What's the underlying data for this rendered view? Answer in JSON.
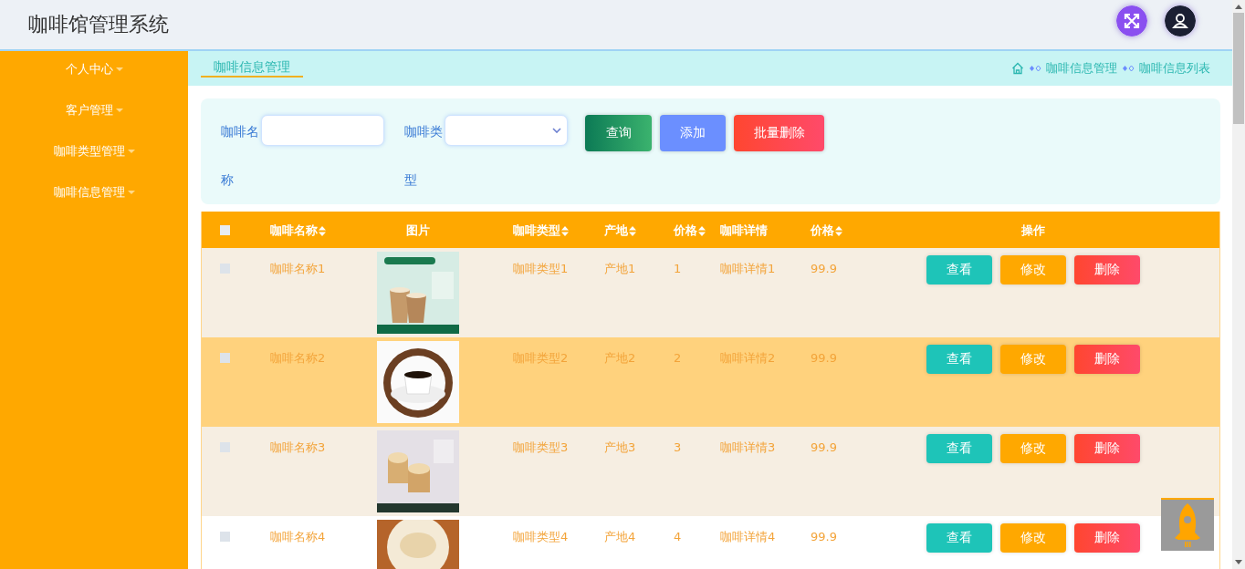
{
  "app": {
    "title": "咖啡馆管理系统"
  },
  "sidebar": {
    "items": [
      {
        "label": "个人中心"
      },
      {
        "label": "客户管理"
      },
      {
        "label": "咖啡类型管理"
      },
      {
        "label": "咖啡信息管理"
      }
    ]
  },
  "tabs": [
    {
      "label": "咖啡信息管理",
      "selected": true
    }
  ],
  "breadcrumb": [
    "咖啡信息管理",
    "咖啡信息列表"
  ],
  "search": {
    "fields": [
      {
        "kind": "text",
        "label": "咖啡名称"
      },
      {
        "kind": "select",
        "label": "咖啡类型"
      }
    ],
    "buttons": [
      {
        "kind": "query",
        "label": "查询"
      },
      {
        "kind": "add",
        "label": "添加"
      },
      {
        "kind": "delete",
        "label": "批量删除"
      }
    ]
  },
  "table": {
    "header_checked": false,
    "columns": [
      {
        "kind": "text",
        "label": "咖啡名称",
        "sortable": true
      },
      {
        "label": "图片",
        "sortable": false
      },
      {
        "kind": "text",
        "label": "咖啡类型",
        "sortable": true
      },
      {
        "kind": "text",
        "label": "产地",
        "sortable": true
      },
      {
        "kind": "text",
        "label": "价格",
        "sortable": true
      },
      {
        "kind": "text",
        "label": "咖啡详情",
        "sortable": false
      },
      {
        "kind": "text",
        "label": "价格",
        "sortable": true
      },
      {
        "kind": "actions",
        "label": "操作",
        "sortable": false
      }
    ],
    "rows": [
      {
        "checked": false,
        "hovered": false,
        "cells": [
          "咖啡名称1",
          "",
          "咖啡类型1",
          "产地1",
          "1",
          "咖啡详情1",
          "99.9"
        ],
        "actions": [
          {
            "kind": "view",
            "label": "查看"
          },
          {
            "kind": "edit",
            "label": "修改"
          },
          {
            "kind": "delete",
            "label": "删除"
          }
        ]
      },
      {
        "checked": false,
        "hovered": true,
        "cells": [
          "咖啡名称2",
          "",
          "咖啡类型2",
          "产地2",
          "2",
          "咖啡详情2",
          "99.9"
        ],
        "actions": [
          {
            "kind": "view",
            "label": "查看"
          },
          {
            "kind": "edit",
            "label": "修改"
          },
          {
            "kind": "delete",
            "label": "删除"
          }
        ]
      },
      {
        "checked": false,
        "hovered": false,
        "cells": [
          "咖啡名称3",
          "",
          "咖啡类型3",
          "产地3",
          "3",
          "咖啡详情3",
          "99.9"
        ],
        "actions": [
          {
            "kind": "view",
            "label": "查看"
          },
          {
            "kind": "edit",
            "label": "修改"
          },
          {
            "kind": "delete",
            "label": "删除"
          }
        ]
      },
      {
        "checked": false,
        "hovered": false,
        "cells": [
          "咖啡名称4",
          "",
          "咖啡类型4",
          "产地4",
          "4",
          "咖啡详情4",
          "99.9"
        ],
        "actions": [
          {
            "kind": "view",
            "label": "查看"
          },
          {
            "kind": "edit",
            "label": "修改"
          },
          {
            "kind": "delete",
            "label": "删除"
          }
        ]
      }
    ]
  }
}
